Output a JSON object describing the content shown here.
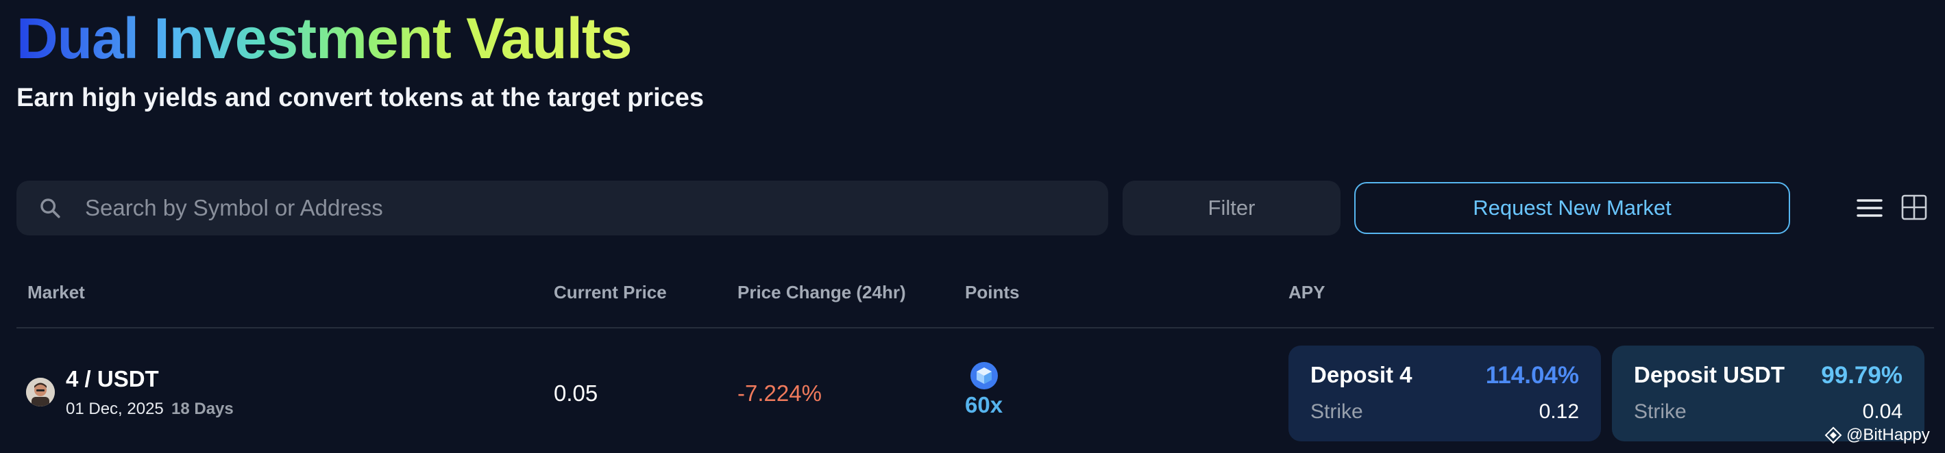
{
  "header": {
    "title": "Dual Investment Vaults",
    "subtitle": "Earn high yields and convert tokens at the target prices"
  },
  "toolbar": {
    "search_placeholder": "Search by Symbol or Address",
    "search_value": "",
    "filter_label": "Filter",
    "request_label": "Request New Market",
    "view_list_icon": "list-view-icon",
    "view_grid_icon": "grid-view-icon"
  },
  "table": {
    "columns": [
      "Market",
      "Current Price",
      "Price Change (24hr)",
      "Points",
      "APY"
    ],
    "rows": [
      {
        "pair": "4 / USDT",
        "date": "01 Dec, 2025",
        "days": "18 Days",
        "price": "0.05",
        "change": "-7.224%",
        "points": "60x",
        "cards": [
          {
            "title": "Deposit 4",
            "apy": "114.04%",
            "strike_label": "Strike",
            "strike_value": "0.12"
          },
          {
            "title": "Deposit USDT",
            "apy": "99.79%",
            "strike_label": "Strike",
            "strike_value": "0.04"
          }
        ]
      }
    ]
  },
  "watermark": {
    "text": "@BitHappy"
  },
  "colors": {
    "background": "#0c1222",
    "accent": "#57b6f0",
    "negative": "#f07a5c",
    "apy_primary": "#4d8bf5",
    "apy_secondary": "#63c3f7"
  }
}
